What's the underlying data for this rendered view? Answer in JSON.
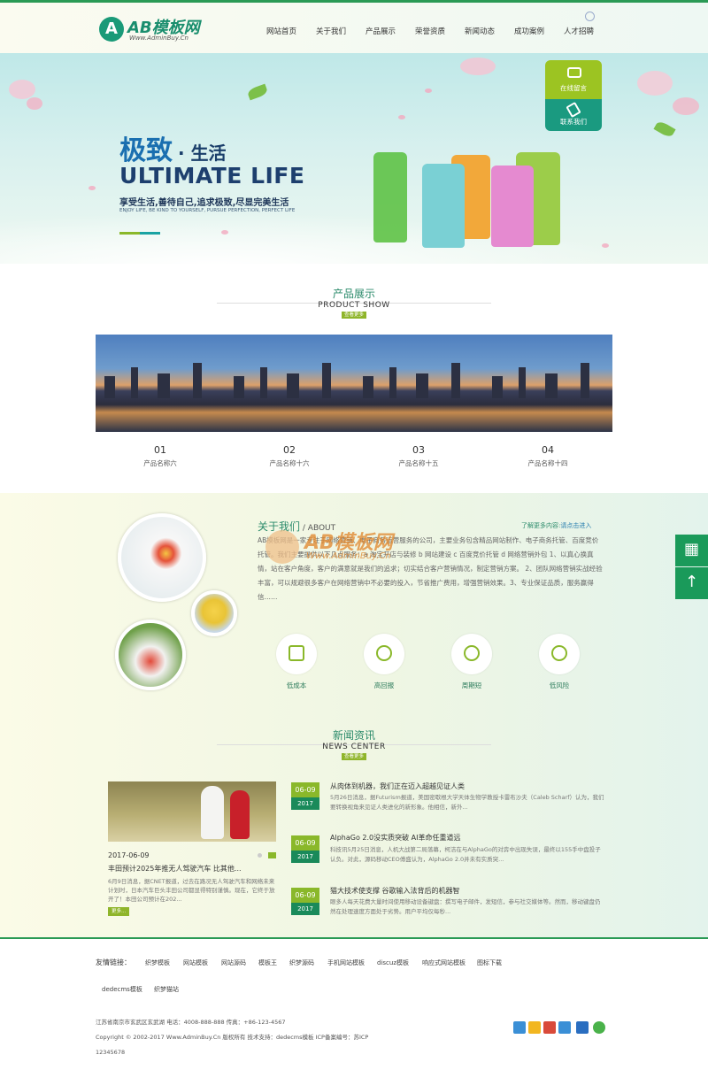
{
  "header": {
    "logo_mark": "A",
    "logo_name": "AB模板网",
    "logo_url": "Www.AdminBuy.Cn",
    "nav": [
      "网站首页",
      "关于我们",
      "产品展示",
      "荣誉资质",
      "新闻动态",
      "成功案例",
      "人才招聘"
    ]
  },
  "banner": {
    "line1a": "极致",
    "line1b": "· 生活",
    "line2": "ULTIMATE  LIFE",
    "line3": "享受生活,善待自己,追求极致,尽显完美生活",
    "line4": "ENJOY LIFE, BE KIND TO YOURSELF, PURSUE PERFECTION, PERFECT LIFE"
  },
  "float_window": {
    "message": "在线留言",
    "contact": "联系我们"
  },
  "products": {
    "title_cn": "产品展示",
    "title_en": "PRODUCT SHOW",
    "more": "查看更多",
    "items": [
      {
        "num": "01",
        "name": "产品名称六"
      },
      {
        "num": "02",
        "name": "产品名称十六"
      },
      {
        "num": "03",
        "name": "产品名称十五"
      },
      {
        "num": "04",
        "name": "产品名称十四"
      }
    ]
  },
  "about": {
    "title_cn": "关于我们",
    "title_sep": " / ",
    "title_en": "ABOUT",
    "more_label": "了解更多内容:",
    "more_link": "请点击进入",
    "text": "AB模板网是一家专注于网络营销、电子商务运营服务的公司，主要业务包含精品网站制作、电子商务托管、百度竞价托管。我们主要提供以下几点服务：a 淘宝开店与装修 b 网站建设 c 百度竞价托管 d 网络营销外包 1、以真心换真情，站在客户角度，客户的满意就是我们的追求；切实结合客户营销情况，制定营销方案。 2、团队网络营销实战经验丰富，可以规避很多客户在网络营销中不必要的投入，节省推广费用，增强营销效果。3、专业保证品质，服务赢得信……",
    "features": [
      "低成本",
      "高回报",
      "周期短",
      "低风险"
    ]
  },
  "watermark": {
    "brand": "AB模板网",
    "url": "Www.AdminBuy.Cn"
  },
  "news": {
    "title_cn": "新闻资讯",
    "title_en": "NEWS CENTER",
    "more": "查看更多",
    "featured": {
      "date": "2017-06-09",
      "title": "丰田预计2025年推无人驾驶汽车 比其他...",
      "summary": "6月9日消息，据CNET报道，过去在路况无人驾驶汽车和网络未来计划时，日本汽车巨头丰田公司都显得特别谨慎。现在，它终于放开了！本田公司预计在202...",
      "more": "更多..."
    },
    "items": [
      {
        "day": "06-09",
        "year": "2017",
        "title": "从肉体到机器，我们正在迈入超越见证人类",
        "summary": "5月26日消息，据Futurism报道，美国密歇根大学天体生物学教授卡雷布沙夫（Caleb Scharf）认为，我们要转换视角来见证人类进化的新形象。他相信，新外..."
      },
      {
        "day": "06-09",
        "year": "2017",
        "title": "AlphaGo 2.0没实质突破 AI革命任重道远",
        "summary": "科技讯5月25日消息，人机大战第二局落幕，柯洁在与AlphaGo的对弈中出现失误，最终以155手中盘投子认负。对此，源码移动CEO傅盛认为，AlphaGo 2.0并未有实质突..."
      },
      {
        "day": "06-09",
        "year": "2017",
        "title": "猫大技术使支撑 谷歌输入法背后的机器智",
        "summary": "眼多人每天花费大量时间使用移动设备键盘：撰写电子邮件，发短信，参与社交媒体等。然而，移动键盘仍然在处理速度方面处于劣势。用户平均仅每秒..."
      }
    ]
  },
  "footer": {
    "links_label": "友情链接：",
    "links": [
      "织梦模板",
      "网站模板",
      "网站源码",
      "模板王",
      "织梦源码",
      "手机网站模板",
      "discuz模板",
      "响应式网站模板",
      "图标下载",
      "dedecms模板",
      "织梦猫站"
    ],
    "address": "江苏省南京市玄武区玄武湖    电话：4008-888-888    传真：+86-123-4567",
    "copyright": "Copyright © 2002-2017 Www.AdminBuy.Cn 版权所有    技术支持：dedecms模板    ICP备案编号：苏ICP",
    "icp": "12345678"
  }
}
